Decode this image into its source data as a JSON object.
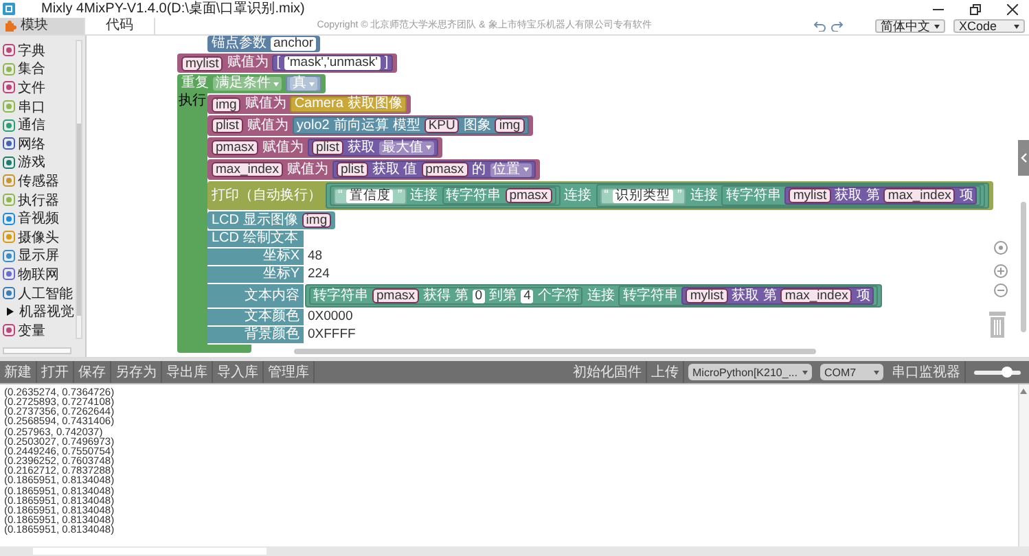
{
  "window": {
    "title": "Mixly 4MixPY-V1.4.0(D:\\桌面\\口罩识别.mix)"
  },
  "tabs": [
    {
      "label": "模块",
      "selected": true
    },
    {
      "label": "代码",
      "selected": false
    }
  ],
  "copyright": "Copyright © 北京师范大学米思齐团队 & 象上市特宝乐机器人有限公司专有软件",
  "language": "简体中文",
  "theme": "XCode",
  "sidebar": {
    "items": [
      {
        "kind": "category",
        "label": "字典"
      },
      {
        "kind": "category",
        "label": "集合"
      },
      {
        "kind": "category",
        "label": "文件"
      },
      {
        "kind": "category",
        "label": "串口"
      },
      {
        "kind": "category",
        "label": "通信"
      },
      {
        "kind": "category",
        "label": "网络"
      },
      {
        "kind": "category",
        "label": "游戏"
      },
      {
        "kind": "category",
        "label": "传感器"
      },
      {
        "kind": "category",
        "label": "执行器"
      },
      {
        "kind": "category",
        "label": "音视频"
      },
      {
        "kind": "category",
        "label": "摄像头"
      },
      {
        "kind": "category",
        "label": "显示屏"
      },
      {
        "kind": "category",
        "label": "物联网"
      },
      {
        "kind": "category",
        "label": "人工智能"
      },
      {
        "kind": "folder",
        "label": "机器视觉",
        "expanded": false
      },
      {
        "kind": "category",
        "label": "变量"
      }
    ]
  },
  "workspace": {
    "blocks": [
      {
        "kind": "param",
        "tokens": [
          {
            "kind": "label",
            "text": "锚点参数"
          },
          {
            "kind": "field",
            "text": "anchor"
          }
        ]
      },
      {
        "kind": "variable",
        "tokens": [
          {
            "kind": "var",
            "text": "mylist"
          },
          {
            "kind": "label",
            "text": "赋值为"
          },
          {
            "kind": "list",
            "tokens": [
              {
                "kind": "label",
                "text": "["
              },
              {
                "kind": "field",
                "text": "'mask','unmask'"
              },
              {
                "kind": "label",
                "text": "]"
              }
            ]
          }
        ]
      },
      {
        "kind": "loop",
        "tokens": [
          {
            "kind": "label",
            "text": "重复"
          },
          {
            "kind": "dropdown",
            "text": "满足条件"
          },
          {
            "kind": "logic",
            "tokens": [
              {
                "kind": "dropdown",
                "text": "真"
              }
            ]
          }
        ],
        "body_label": "执行",
        "body": [
          {
            "kind": "variable",
            "tokens": [
              {
                "kind": "var",
                "text": "img"
              },
              {
                "kind": "label",
                "text": "赋值为"
              },
              {
                "kind": "camera",
                "tokens": [
                  {
                    "kind": "label",
                    "text": "Camera"
                  },
                  {
                    "kind": "label",
                    "text": "获取图像"
                  }
                ]
              }
            ]
          },
          {
            "kind": "variable",
            "tokens": [
              {
                "kind": "var",
                "text": "plist"
              },
              {
                "kind": "label",
                "text": "赋值为"
              },
              {
                "kind": "ai",
                "tokens": [
                  {
                    "kind": "label",
                    "text": "yolo2"
                  },
                  {
                    "kind": "label",
                    "text": "前向运算"
                  },
                  {
                    "kind": "label",
                    "text": "模型"
                  },
                  {
                    "kind": "var",
                    "text": "KPU"
                  },
                  {
                    "kind": "label",
                    "text": "图象"
                  },
                  {
                    "kind": "var",
                    "text": "img"
                  }
                ]
              }
            ]
          },
          {
            "kind": "variable",
            "tokens": [
              {
                "kind": "var",
                "text": "pmasx"
              },
              {
                "kind": "label",
                "text": "赋值为"
              },
              {
                "kind": "list",
                "tokens": [
                  {
                    "kind": "var",
                    "text": "plist"
                  },
                  {
                    "kind": "label",
                    "text": "获取"
                  },
                  {
                    "kind": "dropdown",
                    "text": "最大值"
                  }
                ]
              }
            ]
          },
          {
            "kind": "variable",
            "tokens": [
              {
                "kind": "var",
                "text": "max_index"
              },
              {
                "kind": "label",
                "text": "赋值为"
              },
              {
                "kind": "list",
                "tokens": [
                  {
                    "kind": "var",
                    "text": "plist"
                  },
                  {
                    "kind": "label",
                    "text": "获取 值"
                  },
                  {
                    "kind": "var",
                    "text": "pmasx"
                  },
                  {
                    "kind": "label",
                    "text": "的"
                  },
                  {
                    "kind": "dropdown",
                    "text": "位置"
                  }
                ]
              }
            ]
          },
          {
            "kind": "print",
            "tokens": [
              {
                "kind": "label",
                "text": "打印（自动换行）"
              },
              {
                "kind": "text",
                "tokens": [
                  {
                    "kind": "text",
                    "tokens": [
                      {
                        "kind": "string",
                        "tokens": [
                          {
                            "kind": "label",
                            "text": "“"
                          },
                          {
                            "kind": "field",
                            "text": "置信度"
                          },
                          {
                            "kind": "label",
                            "text": "”"
                          }
                        ]
                      },
                      {
                        "kind": "label",
                        "text": "连接"
                      },
                      {
                        "kind": "text",
                        "tokens": [
                          {
                            "kind": "label",
                            "text": "转字符串"
                          },
                          {
                            "kind": "var",
                            "text": "pmasx"
                          }
                        ]
                      }
                    ]
                  },
                  {
                    "kind": "label",
                    "text": "连接"
                  },
                  {
                    "kind": "text",
                    "tokens": [
                      {
                        "kind": "string",
                        "tokens": [
                          {
                            "kind": "label",
                            "text": "“"
                          },
                          {
                            "kind": "field",
                            "text": "识别类型"
                          },
                          {
                            "kind": "label",
                            "text": "”"
                          }
                        ]
                      },
                      {
                        "kind": "label",
                        "text": "连接"
                      },
                      {
                        "kind": "text",
                        "tokens": [
                          {
                            "kind": "label",
                            "text": "转字符串"
                          },
                          {
                            "kind": "list",
                            "tokens": [
                              {
                                "kind": "var",
                                "text": "mylist"
                              },
                              {
                                "kind": "label",
                                "text": "获取 第"
                              },
                              {
                                "kind": "var",
                                "text": "max_index"
                              },
                              {
                                "kind": "label",
                                "text": "项"
                              }
                            ]
                          }
                        ]
                      }
                    ]
                  }
                ]
              }
            ]
          },
          {
            "kind": "display",
            "tokens": [
              {
                "kind": "label",
                "text": "LCD 显示图像"
              },
              {
                "kind": "var",
                "text": "img"
              }
            ]
          },
          {
            "kind": "display",
            "tokens": [
              {
                "kind": "label",
                "text": "LCD 绘制文本"
              }
            ],
            "inputs": [
              {
                "label": "坐标X",
                "tokens": [
                  {
                    "kind": "field",
                    "text": "48"
                  }
                ]
              },
              {
                "label": "坐标Y",
                "tokens": [
                  {
                    "kind": "field",
                    "text": "224"
                  }
                ]
              },
              {
                "label": "文本内容",
                "tokens": [
                  {
                    "kind": "text",
                    "tokens": [
                      {
                        "kind": "text",
                        "tokens": [
                          {
                            "kind": "label",
                            "text": "转字符串"
                          },
                          {
                            "kind": "var",
                            "text": "pmasx"
                          },
                          {
                            "kind": "label",
                            "text": "获得 第"
                          },
                          {
                            "kind": "field",
                            "text": "0"
                          },
                          {
                            "kind": "label",
                            "text": "到第"
                          },
                          {
                            "kind": "field",
                            "text": "4"
                          },
                          {
                            "kind": "label",
                            "text": "个字符"
                          }
                        ]
                      },
                      {
                        "kind": "label",
                        "text": "连接"
                      },
                      {
                        "kind": "text",
                        "tokens": [
                          {
                            "kind": "label",
                            "text": "转字符串"
                          },
                          {
                            "kind": "list",
                            "tokens": [
                              {
                                "kind": "var",
                                "text": "mylist"
                              },
                              {
                                "kind": "label",
                                "text": "获取 第"
                              },
                              {
                                "kind": "var",
                                "text": "max_index"
                              },
                              {
                                "kind": "label",
                                "text": "项"
                              }
                            ]
                          }
                        ]
                      }
                    ]
                  }
                ]
              },
              {
                "label": "文本颜色",
                "tokens": [
                  {
                    "kind": "field",
                    "text": "0X0000"
                  }
                ]
              },
              {
                "label": "背景颜色",
                "tokens": [
                  {
                    "kind": "field",
                    "text": "0XFFFF"
                  }
                ]
              }
            ]
          }
        ]
      }
    ]
  },
  "toolbar": {
    "left_buttons": [
      "新建",
      "打开",
      "保存",
      "另存为",
      "导出库",
      "导入库",
      "管理库"
    ],
    "init_firmware": "初始化固件",
    "upload": "上传",
    "board": "MicroPython[K210_...",
    "port": "COM7",
    "serial_monitor": "串口监视器",
    "slider": {
      "level": 0.7
    }
  },
  "console": {
    "lines": [
      "(0.2635274, 0.7364726)",
      "(0.2725893, 0.7274108)",
      "(0.2737356, 0.7262644)",
      "(0.2568594, 0.7431406)",
      "(0.257963, 0.742037)",
      "(0.2503027, 0.7496973)",
      "(0.2449246, 0.7550754)",
      "(0.2396252, 0.7603748)",
      "(0.2162712, 0.7837288)",
      "(0.1865951, 0.8134048)",
      "(0.1865951, 0.8134048)",
      "(0.1865951, 0.8134048)",
      "(0.1865951, 0.8134048)",
      "(0.1865951, 0.8134048)",
      "(0.1865951, 0.8134048)"
    ]
  }
}
